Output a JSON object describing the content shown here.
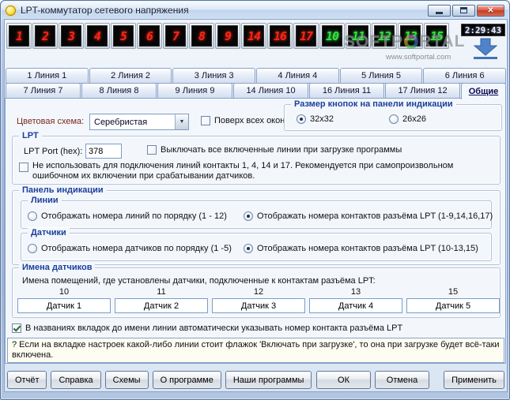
{
  "window": {
    "title": "LPT-коммутатор сетевого напряжения"
  },
  "icons": {
    "close_glyph": "✕",
    "dropdown_arrow": "▼"
  },
  "watermark": {
    "brand_left": "SOFTP",
    "brand_right": "RTAL",
    "url": "www.softportal.com"
  },
  "led_panel": {
    "clock": "2:29:43",
    "buttons": [
      {
        "label": "1",
        "color": "red"
      },
      {
        "label": "2",
        "color": "red"
      },
      {
        "label": "3",
        "color": "red"
      },
      {
        "label": "4",
        "color": "red"
      },
      {
        "label": "5",
        "color": "red"
      },
      {
        "label": "6",
        "color": "red"
      },
      {
        "label": "7",
        "color": "red"
      },
      {
        "label": "8",
        "color": "red"
      },
      {
        "label": "9",
        "color": "red"
      },
      {
        "label": "14",
        "color": "red"
      },
      {
        "label": "16",
        "color": "red"
      },
      {
        "label": "17",
        "color": "red"
      },
      {
        "label": "10",
        "color": "green"
      },
      {
        "label": "11",
        "color": "green"
      },
      {
        "label": "12",
        "color": "green"
      },
      {
        "label": "13",
        "color": "green"
      },
      {
        "label": "15",
        "color": "green"
      }
    ]
  },
  "tabs": {
    "row1": [
      "1 Линия 1",
      "2 Линия 2",
      "3 Линия 3",
      "4 Линия 4",
      "5 Линия 5",
      "6 Линия 6"
    ],
    "row2": [
      "7 Линия 7",
      "8 Линия 8",
      "9 Линия 9",
      "14 Линия 10",
      "16 Линия 11",
      "17 Линия 12"
    ],
    "active": "Общие"
  },
  "general": {
    "color_scheme_label": "Цветовая схема:",
    "color_scheme_value": "Серебристая",
    "always_on_top": "Поверх всех окон",
    "button_size_group": {
      "title": "Размер кнопок на панели индикации",
      "option_32": "32x32",
      "option_26": "26x26"
    },
    "lpt_group": {
      "title": "LPT",
      "port_label": "LPT Port (hex):",
      "port_value": "378",
      "switch_off_checkbox": "Выключать все включенные линии при загрузке программы",
      "contacts_checkbox": "Не использовать для подключения линий контакты 1, 4, 14 и 17. Рекомендуется при самопроизвольном ошибочном их включении при срабатывании датчиков."
    },
    "indication_group": {
      "title": "Панель индикации",
      "lines": {
        "title": "Линии",
        "option_order": "Отображать номера линий по порядку (1 - 12)",
        "option_contacts": "Отображать номера контактов разъёма LPT  (1-9,14,16,17)"
      },
      "sensors": {
        "title": "Датчики",
        "option_order": "Отображать номера датчиков по порядку (1 -5)",
        "option_contacts": "Отображать номера контактов разъёма LPT (10-13,15)"
      }
    },
    "sensor_names_group": {
      "title": "Имена датчиков",
      "description": "Имена помещений, где установлены датчики, подключенные к контактам разъёма LPT:",
      "sensors": [
        {
          "contact": "10",
          "name": "Датчик 1"
        },
        {
          "contact": "11",
          "name": "Датчик 2"
        },
        {
          "contact": "12",
          "name": "Датчик 3"
        },
        {
          "contact": "13",
          "name": "Датчик 4"
        },
        {
          "contact": "15",
          "name": "Датчик 5"
        }
      ]
    },
    "tab_naming_checkbox": "В названиях вкладок до имени линии автоматически указывать номер контакта разъёма LPT",
    "hint": "? Если на вкладке настроек какой-либо линии стоит флажок 'Включать при загрузке', то она при загрузке будет всё-таки включена."
  },
  "footer": {
    "left_buttons": [
      "Отчёт",
      "Справка",
      "Схемы",
      "О программе",
      "Наши программы"
    ],
    "right_buttons": [
      "ОК",
      "Отмена",
      "Применить"
    ]
  }
}
